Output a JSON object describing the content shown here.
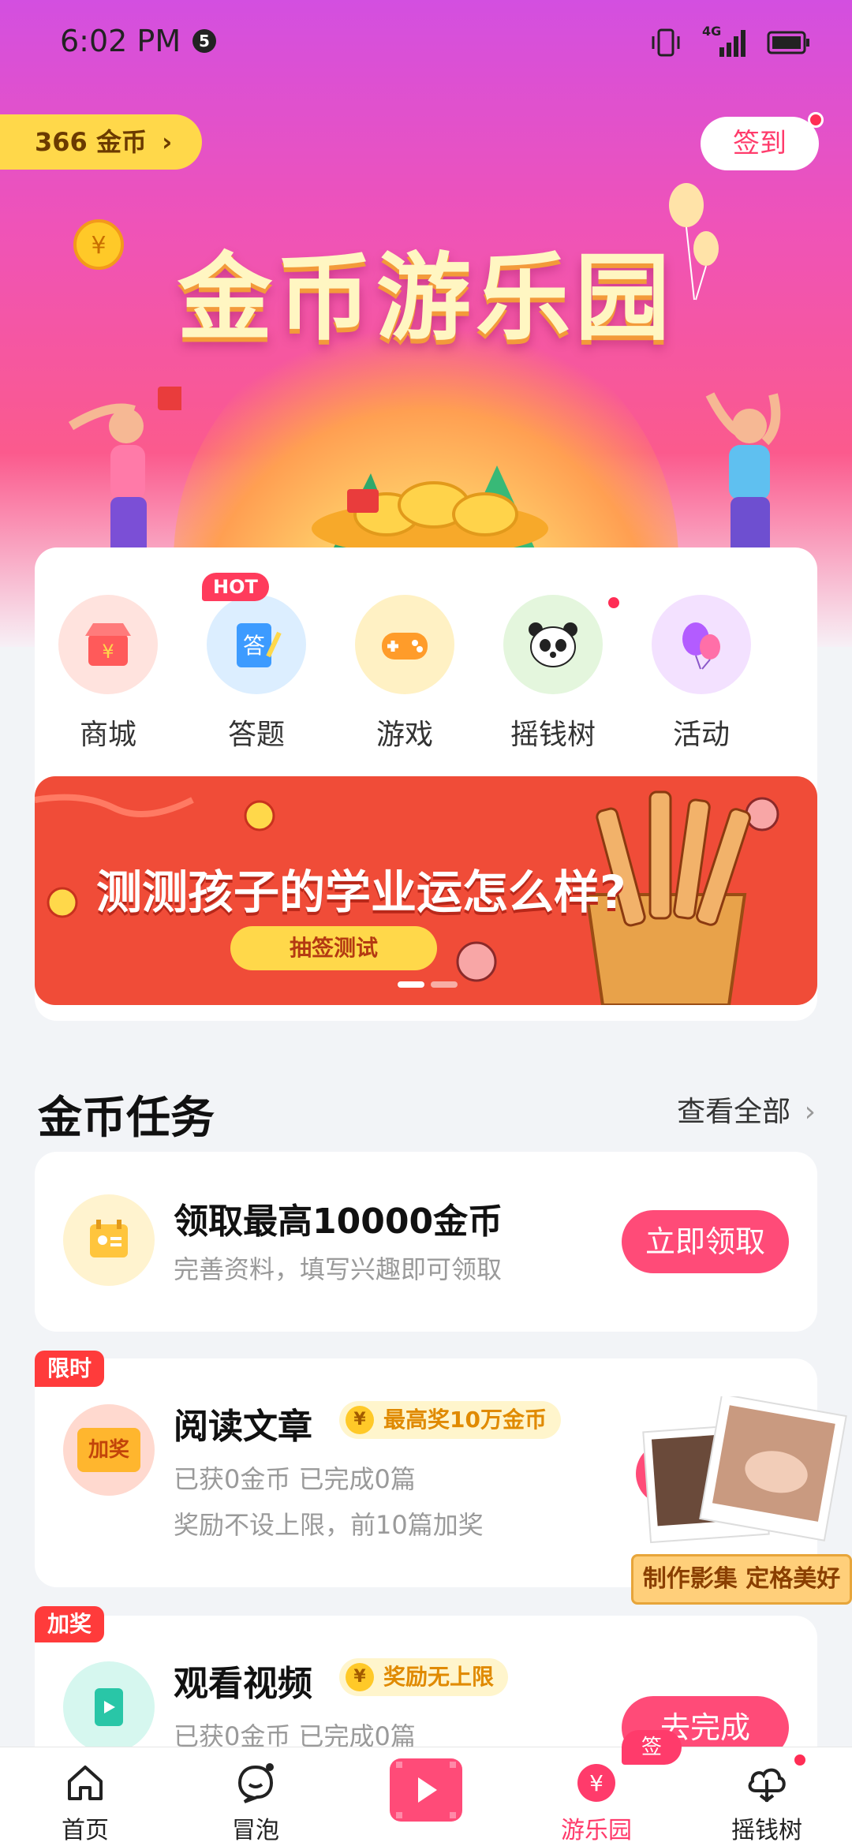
{
  "status_bar": {
    "time": "6:02 PM",
    "notification_count": "5",
    "network": "4G"
  },
  "header": {
    "coins": "366 金币",
    "sign_in": "签到"
  },
  "hero": {
    "title": "金币游乐园"
  },
  "quick_menu": [
    {
      "label": "商城",
      "icon": "shop-icon"
    },
    {
      "label": "答题",
      "icon": "quiz-icon",
      "badge": "HOT"
    },
    {
      "label": "游戏",
      "icon": "gamepad-icon"
    },
    {
      "label": "摇钱树",
      "icon": "panda-icon"
    },
    {
      "label": "活动",
      "icon": "balloon-icon"
    }
  ],
  "banner": {
    "title": "测测孩子的学业运怎么样?",
    "button": "抽签测试"
  },
  "tasks_section": {
    "title": "金币任务",
    "see_all": "查看全部"
  },
  "tasks": [
    {
      "title": "领取最高10000金币",
      "desc": "完善资料，填写兴趣即可领取",
      "button": "立即领取"
    },
    {
      "tag": "限时",
      "title": "阅读文章",
      "chip": "最高奖10万金币",
      "desc": "已获0金币 已完成0篇",
      "desc2": "奖励不设上限，前10篇加奖",
      "icon_text": "加奖"
    },
    {
      "tag": "加奖",
      "title": "观看视频",
      "chip": "奖励无上限",
      "desc": "已获0金币 已完成0篇",
      "button": "去完成"
    }
  ],
  "float_ad": {
    "caption": "制作影集 定格美好"
  },
  "tab_bar": [
    {
      "label": "首页"
    },
    {
      "label": "冒泡"
    },
    {
      "label": ""
    },
    {
      "label": "游乐园",
      "badge": "签到"
    },
    {
      "label": "摇钱树"
    }
  ],
  "colors": {
    "accent": "#ff4b78",
    "tab_active": "#ff3b6b",
    "coin": "#ffd84a"
  }
}
